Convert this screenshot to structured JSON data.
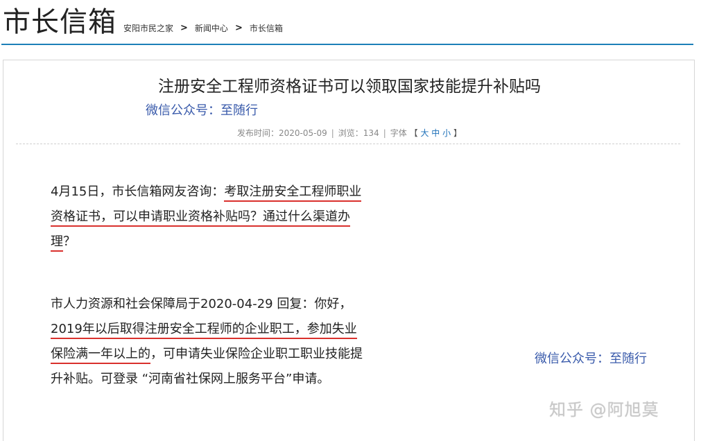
{
  "header": {
    "title": "市长信箱",
    "breadcrumb": [
      "安阳市民之家",
      "新闻中心",
      "市长信箱"
    ],
    "separator": ">"
  },
  "article": {
    "title": "注册安全工程师资格证书可以领取国家技能提升补贴吗",
    "wechat_label": "微信公众号：至随行",
    "meta": {
      "publish": "发布时间：2020-05-09",
      "views": "浏览：134",
      "font_label": "字体",
      "open_bracket": "【",
      "size_large": "大",
      "size_medium": "中",
      "size_small": "小",
      "close_bracket": "】"
    },
    "para1": {
      "plain": "4月15日，市长信箱网友咨询：",
      "underlined": "考取注册安全工程师职业资格证书，可以申请职业资格补贴吗？通过什么渠道办理",
      "tail": "？"
    },
    "para2": {
      "plain": "市人力资源和社会保障局于2020-04-29 回复：你好，",
      "underlined": "2019年以后取得注册安全工程师的企业职工，参加失业保险满一年以上的",
      "tail": "，可申请失业保险企业职工职业技能提升补贴。可登录 “河南省社保网上服务平台”申请。"
    },
    "wechat_side": "微信公众号：至随行",
    "watermark": "知乎 @阿旭莫"
  },
  "colors": {
    "accent_rule": "#1c7fb8",
    "link_blue": "#3a5bab",
    "underline_red": "#d9302c"
  }
}
